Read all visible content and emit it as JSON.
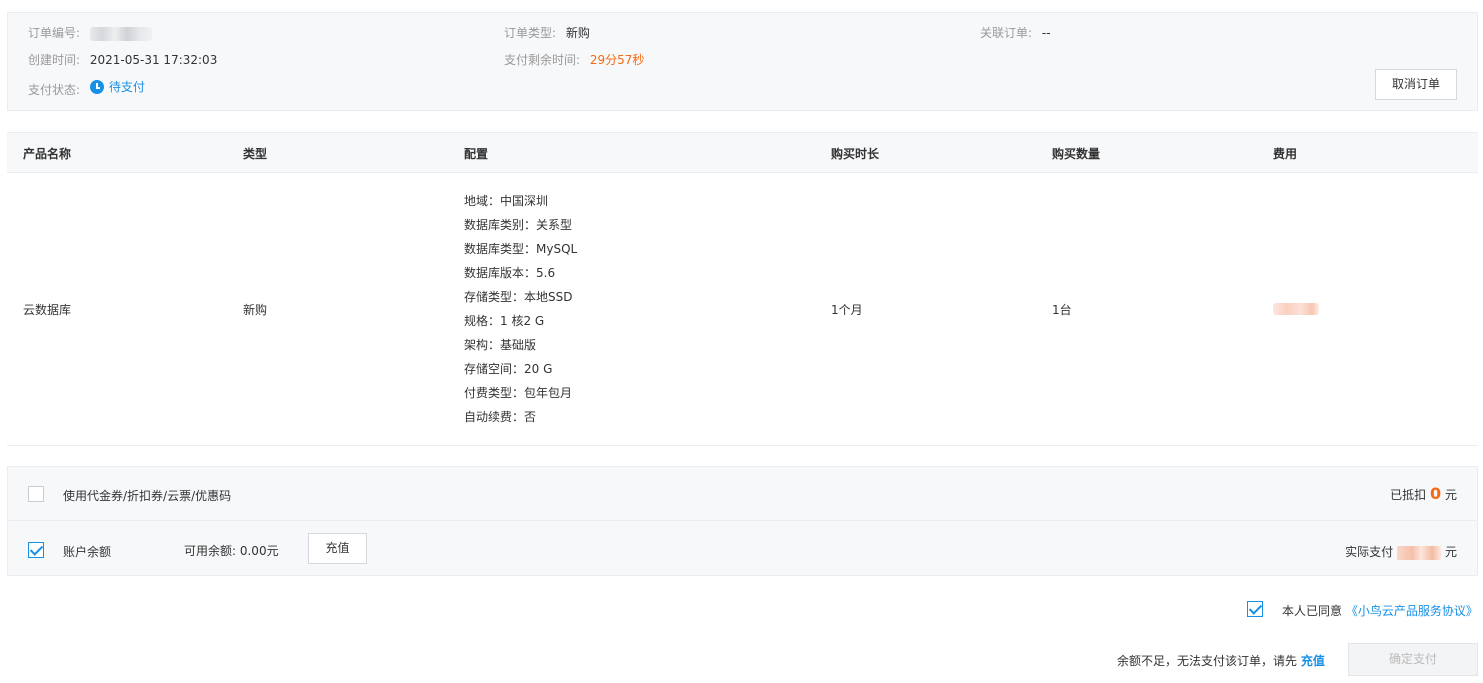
{
  "order": {
    "order_no_label": "订单编号:",
    "order_type_label": "订单类型:",
    "order_type_value": "新购",
    "related_order_label": "关联订单:",
    "related_order_value": "--",
    "created_label": "创建时间:",
    "created_value": "2021-05-31 17:32:03",
    "remaining_label": "支付剩余时间:",
    "remaining_value": "29分57秒",
    "status_label": "支付状态:",
    "status_value": "待支付",
    "cancel_button": "取消订单"
  },
  "table": {
    "headers": [
      "产品名称",
      "类型",
      "配置",
      "购买时长",
      "购买数量",
      "费用"
    ],
    "row": {
      "product": "云数据库",
      "type": "新购",
      "config": [
        "地域：中国深圳",
        "数据库类别：关系型",
        "数据库类型：MySQL",
        "数据库版本：5.6",
        "存储类型：本地SSD",
        "规格：1 核2 G",
        "架构：基础版",
        "存储空间：20 G",
        "付费类型：包年包月",
        "自动续费：否"
      ],
      "duration": "1个月",
      "quantity": "1台"
    }
  },
  "payment": {
    "coupon_label": "使用代金券/折扣券/云票/优惠码",
    "coupon_checked": false,
    "deducted_label": "已抵扣",
    "deducted_amount": "0",
    "deducted_unit": "元",
    "balance_label": "账户余额",
    "balance_checked": true,
    "available_label": "可用余额: 0.00元",
    "recharge_button": "充值",
    "actual_label": "实际支付",
    "actual_unit": "元"
  },
  "agreement": {
    "checked": true,
    "text": "本人已同意",
    "link": "《小鸟云产品服务协议》"
  },
  "footer": {
    "insufficient_text": "余额不足，无法支付该订单，请先",
    "recharge_link": "充值",
    "confirm_button": "确定支付"
  },
  "colors": {
    "accent": "#1890e6",
    "warning": "#f56a12",
    "panel_bg": "#f7f8fa"
  },
  "icons": {
    "status": "clock-icon",
    "checkbox": "checkmark-icon"
  }
}
